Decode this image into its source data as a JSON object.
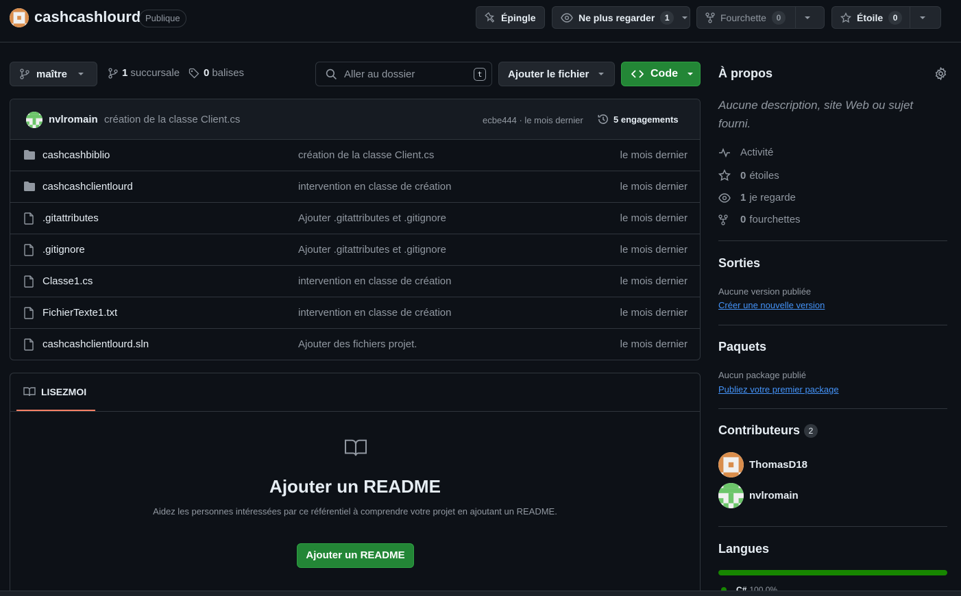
{
  "repo": {
    "name": "cashcashlourd",
    "visibility": "Publique"
  },
  "header_actions": {
    "pin_label": "Épingle",
    "watch_label": "Ne plus regarder",
    "watch_count": "1",
    "fork_label": "Fourchette",
    "fork_count": "0",
    "star_label": "Étoile",
    "star_count": "0"
  },
  "toolbar": {
    "branch": "maître",
    "branches_count": "1",
    "branches_label": "succursale",
    "tags_count": "0",
    "tags_label": "balises",
    "search_placeholder": "Aller au dossier",
    "search_shortcut": "t",
    "add_file_label": "Ajouter le fichier",
    "code_label": "Code"
  },
  "latest_commit": {
    "author": "nvlromain",
    "message": "création de la classe Client.cs",
    "sha_time": "ecbe444 · le mois dernier",
    "commits_count": "5",
    "commits_label": "engagements"
  },
  "files": [
    {
      "type": "folder",
      "name": "cashcashbiblio",
      "message": "création de la classe Client.cs",
      "date": "le mois dernier"
    },
    {
      "type": "folder",
      "name": "cashcashclientlourd",
      "message": "intervention en classe de création",
      "date": "le mois dernier"
    },
    {
      "type": "file",
      "name": ".gitattributes",
      "message": "Ajouter .gitattributes et .gitignore",
      "date": "le mois dernier"
    },
    {
      "type": "file",
      "name": ".gitignore",
      "message": "Ajouter .gitattributes et .gitignore",
      "date": "le mois dernier"
    },
    {
      "type": "file",
      "name": "Classe1.cs",
      "message": "intervention en classe de création",
      "date": "le mois dernier"
    },
    {
      "type": "file",
      "name": "FichierTexte1.txt",
      "message": "intervention en classe de création",
      "date": "le mois dernier"
    },
    {
      "type": "file",
      "name": "cashcashclientlourd.sln",
      "message": "Ajouter des fichiers projet.",
      "date": "le mois dernier"
    }
  ],
  "readme": {
    "tab_label": "LISEZMOI",
    "title": "Ajouter un README",
    "subtitle": "Aidez les personnes intéressées par ce référentiel à comprendre votre projet en ajoutant un README.",
    "button_label": "Ajouter un README"
  },
  "about": {
    "title": "À propos",
    "description": "Aucune description, site Web ou sujet fourni.",
    "activity_label": "Activité",
    "stars_count": "0",
    "stars_label": "étoiles",
    "watching_count": "1",
    "watching_label": "je regarde",
    "forks_count": "0",
    "forks_label": "fourchettes"
  },
  "releases": {
    "title": "Sorties",
    "empty_text": "Aucune version publiée",
    "link": "Créer une nouvelle version"
  },
  "packages": {
    "title": "Paquets",
    "empty_text": "Aucun package publié",
    "link": "Publiez votre premier package"
  },
  "contributors": {
    "title": "Contributeurs",
    "count": "2",
    "list": [
      {
        "name": "ThomasD18"
      },
      {
        "name": "nvlromain"
      }
    ]
  },
  "languages": {
    "title": "Langues",
    "items": [
      {
        "name": "C#",
        "percent": "100,0%",
        "color": "#178600"
      }
    ]
  },
  "colors": {
    "background": "#0d1117",
    "accent_green": "#238636",
    "link_blue": "#4493f8",
    "tab_underline": "#f78166"
  }
}
